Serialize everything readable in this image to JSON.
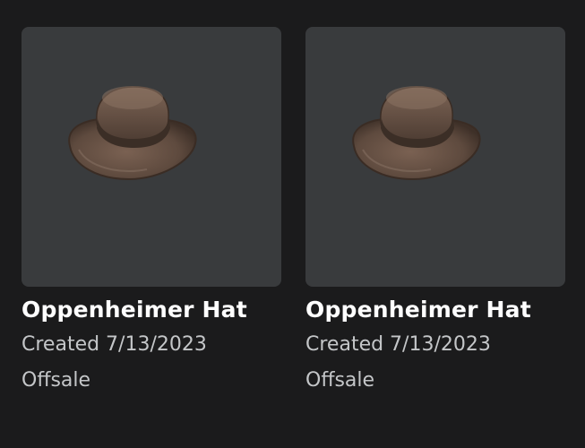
{
  "items": [
    {
      "name": "Oppenheimer Hat",
      "created": "Created 7/13/2023",
      "status": "Offsale",
      "thumbnail_icon": "brown-fedora-hat-icon"
    },
    {
      "name": "Oppenheimer Hat",
      "created": "Created 7/13/2023",
      "status": "Offsale",
      "thumbnail_icon": "brown-fedora-hat-icon"
    }
  ],
  "colors": {
    "background": "#1b1b1c",
    "thumbnail_bg": "#393b3d",
    "title": "#ffffff",
    "meta": "#c4c6c8",
    "hat_brown": "#6b5548"
  }
}
